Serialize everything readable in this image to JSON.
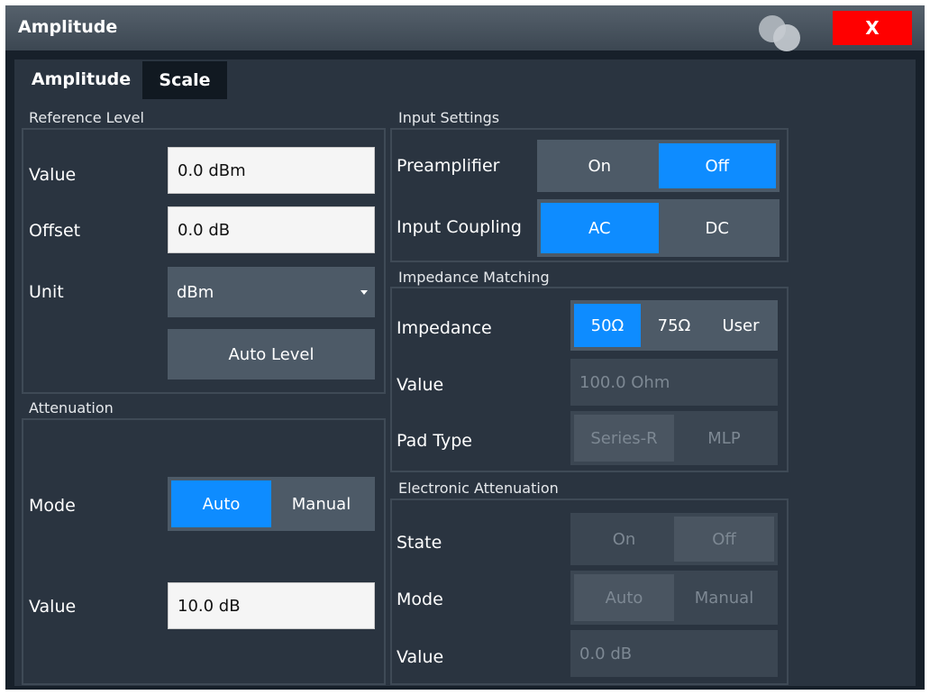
{
  "window": {
    "title": "Amplitude",
    "close_label": "X"
  },
  "tabs": [
    {
      "label": "Amplitude",
      "active": true
    },
    {
      "label": "Scale",
      "active": false
    }
  ],
  "reference_level": {
    "title": "Reference Level",
    "value_label": "Value",
    "value": "0.0 dBm",
    "offset_label": "Offset",
    "offset": "0.0 dB",
    "unit_label": "Unit",
    "unit": "dBm",
    "auto_level_label": "Auto Level"
  },
  "attenuation": {
    "title": "Attenuation",
    "mode_label": "Mode",
    "mode_options": [
      "Auto",
      "Manual"
    ],
    "mode_selected": "Auto",
    "value_label": "Value",
    "value": "10.0 dB"
  },
  "input_settings": {
    "title": "Input Settings",
    "preamp_label": "Preamplifier",
    "preamp_options": [
      "On",
      "Off"
    ],
    "preamp_selected": "Off",
    "coupling_label": "Input Coupling",
    "coupling_options": [
      "AC",
      "DC"
    ],
    "coupling_selected": "AC"
  },
  "impedance_matching": {
    "title": "Impedance Matching",
    "impedance_label": "Impedance",
    "impedance_options": [
      "50Ω",
      "75Ω",
      "User"
    ],
    "impedance_selected": "50Ω",
    "value_label": "Value",
    "value": "100.0 Ohm",
    "pad_label": "Pad Type",
    "pad_options": [
      "Series-R",
      "MLP"
    ],
    "pad_selected": "Series-R"
  },
  "electronic_attenuation": {
    "title": "Electronic Attenuation",
    "state_label": "State",
    "state_options": [
      "On",
      "Off"
    ],
    "state_selected": "Off",
    "mode_label": "Mode",
    "mode_options": [
      "Auto",
      "Manual"
    ],
    "mode_selected": "Auto",
    "value_label": "Value",
    "value": "0.0 dB"
  },
  "colors": {
    "accent": "#0e8cff",
    "close": "#ff0000",
    "panel": "#2a3440",
    "background": "#17202a"
  }
}
